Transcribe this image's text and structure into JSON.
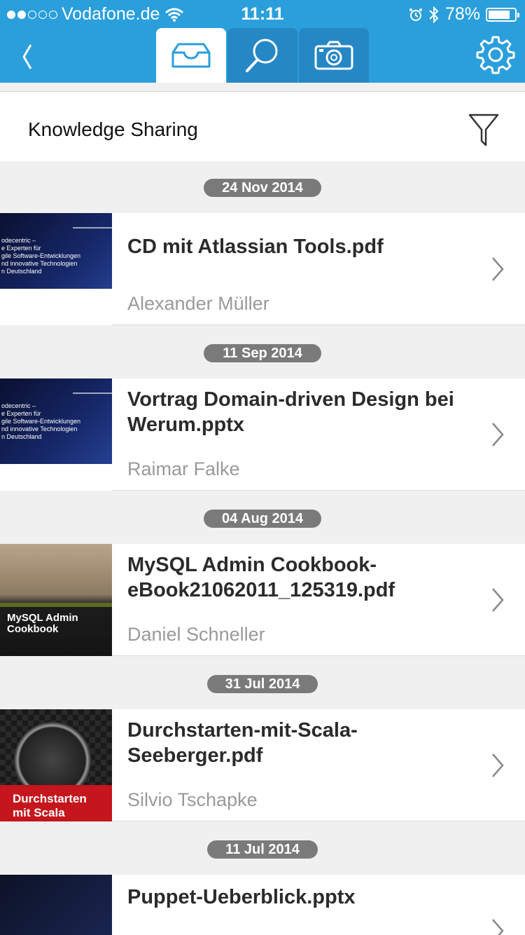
{
  "status_bar": {
    "carrier": "Vodafone.de",
    "time": "11:11",
    "battery": "78%",
    "battery_level": 0.78
  },
  "colors": {
    "header": "#2a9fdc",
    "tab_inactive": "#2687c5",
    "badge": "#7a7a7a"
  },
  "nav": {
    "back_icon": "chevron-left-icon",
    "tabs": [
      {
        "name": "inbox",
        "icon": "inbox-tray-icon",
        "active": true
      },
      {
        "name": "search",
        "icon": "search-icon",
        "active": false
      },
      {
        "name": "camera",
        "icon": "camera-icon",
        "active": false
      }
    ],
    "settings_icon": "gear-icon"
  },
  "list_header": {
    "title": "Knowledge Sharing",
    "filter_icon": "filter-funnel-icon"
  },
  "entries": [
    {
      "date": "24 Nov 2014",
      "title": "CD mit Atlassian Tools.pdf",
      "author": "Alexander Müller",
      "thumb_text": "odecentric –\ne Experten für\ngile Software-Entwicklungen\nnd innovative Technologien\nn Deutschland"
    },
    {
      "date": "11 Sep 2014",
      "title": "Vortrag Domain-driven Design bei Werum.pptx",
      "author": "Raimar Falke",
      "thumb_text": "odecentric –\ne Experten für\ngile Software-Entwicklungen\nnd innovative Technologien\nn Deutschland"
    },
    {
      "date": "04 Aug 2014",
      "title": "MySQL Admin Cookbook-eBook21062011_125319.pdf",
      "author": "Daniel Schneller",
      "thumb_text": "MySQL Admin\nCookbook"
    },
    {
      "date": "31 Jul 2014",
      "title": "Durchstarten-mit-Scala-Seeberger.pdf",
      "author": "Silvio Tschapke",
      "thumb_text": "Durchstarten\nmit Scala"
    },
    {
      "date": "11 Jul 2014",
      "title": "Puppet-Ueberblick.pptx",
      "author": ""
    }
  ]
}
